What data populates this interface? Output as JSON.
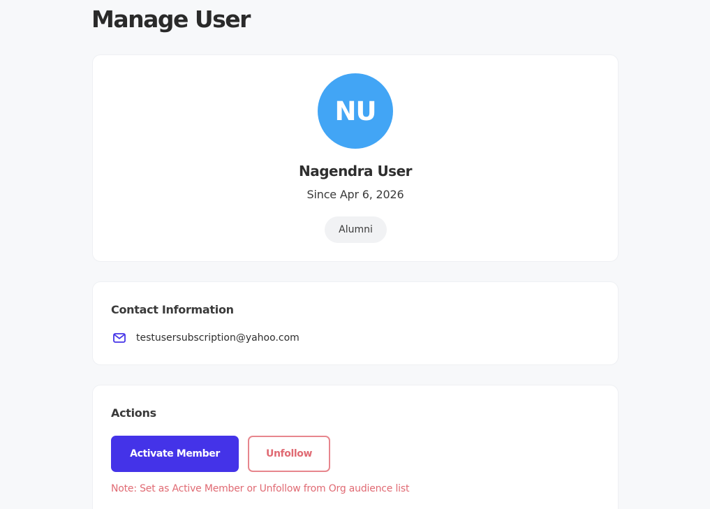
{
  "page": {
    "title": "Manage User"
  },
  "profile": {
    "initials": "NU",
    "name": "Nagendra User",
    "since": "Since Apr 6, 2026",
    "role": "Alumni",
    "avatar_color": "#42a5f5"
  },
  "contact": {
    "section_title": "Contact Information",
    "email": "testusersubscription@yahoo.com",
    "icon": "mail-icon"
  },
  "actions": {
    "section_title": "Actions",
    "activate_label": "Activate Member",
    "unfollow_label": "Unfollow",
    "note": "Note: Set as Active Member or Unfollow from Org audience list",
    "primary_color": "#4433e8",
    "danger_color": "#e06a73"
  }
}
